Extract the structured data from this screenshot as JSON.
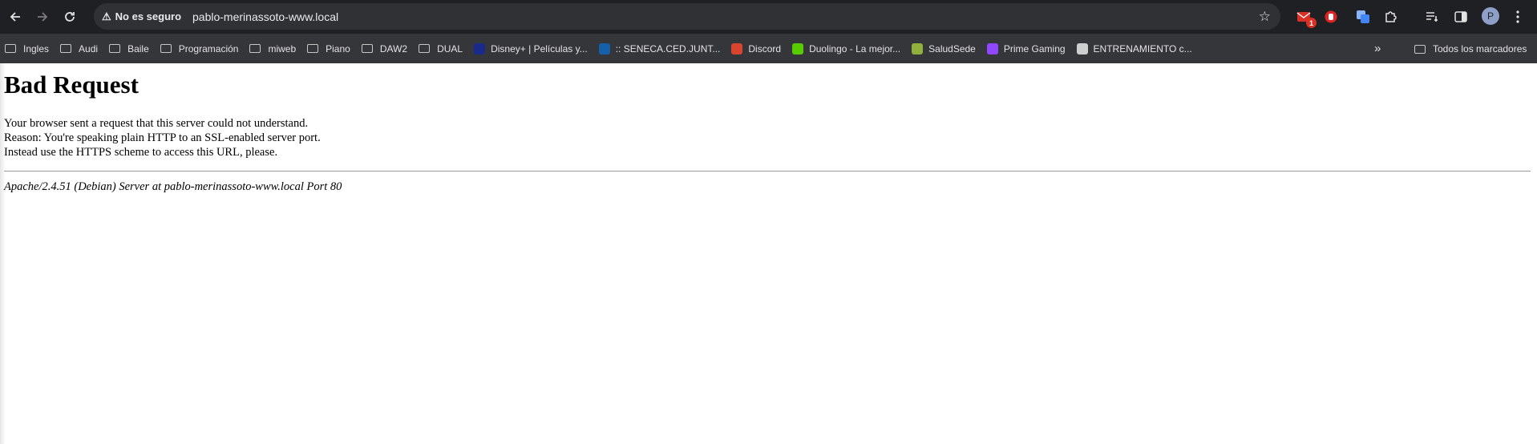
{
  "browser": {
    "security_label": "No es seguro",
    "url": "pablo-merinassoto-www.local",
    "extension_badge": "1",
    "avatar_letter": "P"
  },
  "bookmarks": [
    {
      "label": "Ingles",
      "kind": "folder"
    },
    {
      "label": "Audi",
      "kind": "folder"
    },
    {
      "label": "Baile",
      "kind": "folder"
    },
    {
      "label": "Programación",
      "kind": "folder"
    },
    {
      "label": "miweb",
      "kind": "folder"
    },
    {
      "label": "Piano",
      "kind": "folder"
    },
    {
      "label": "DAW2",
      "kind": "folder"
    },
    {
      "label": "DUAL",
      "kind": "folder"
    },
    {
      "label": "Disney+ | Películas y...",
      "kind": "site",
      "color": "#1a2a8c"
    },
    {
      "label": ":: SENECA.CED.JUNT...",
      "kind": "site",
      "color": "#1460aa"
    },
    {
      "label": "Discord",
      "kind": "site",
      "color": "#d9442e"
    },
    {
      "label": "Duolingo - La mejor...",
      "kind": "site",
      "color": "#58cc02"
    },
    {
      "label": "SaludSede",
      "kind": "site",
      "color": "#8fb03a"
    },
    {
      "label": "Prime Gaming",
      "kind": "site",
      "color": "#9146ff"
    },
    {
      "label": "ENTRENAMIENTO c...",
      "kind": "site",
      "color": "#cfcfcf"
    }
  ],
  "bookmarks_all_label": "Todos los marcadores",
  "page": {
    "title": "Bad Request",
    "lines": [
      "Your browser sent a request that this server could not understand.",
      "Reason: You're speaking plain HTTP to an SSL-enabled server port.",
      "Instead use the HTTPS scheme to access this URL, please."
    ],
    "server_address": "Apache/2.4.51 (Debian) Server at pablo-merinassoto-www.local Port 80"
  }
}
